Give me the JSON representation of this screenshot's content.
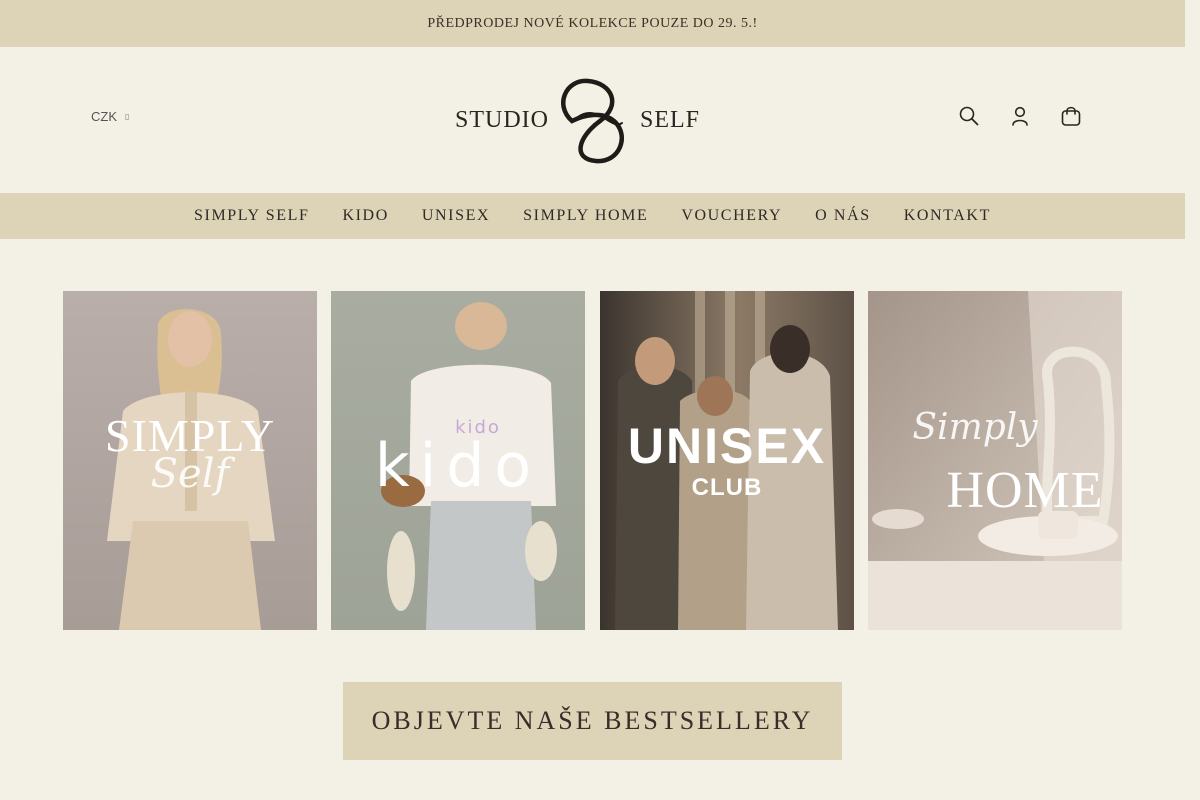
{
  "announcement": "PŘEDPRODEJ NOVÉ KOLEKCE POUZE DO 29. 5.!",
  "header": {
    "currency": "CZK",
    "logo_left": "STUDIO",
    "logo_right": "SELF"
  },
  "icons": [
    "search-icon",
    "account-icon",
    "cart-icon"
  ],
  "nav": {
    "items": [
      "SIMPLY SELF",
      "KIDO",
      "UNISEX",
      "SIMPLY HOME",
      "VOUCHERY",
      "O NÁS",
      "KONTAKT"
    ]
  },
  "tiles": [
    {
      "title": "SIMPLY",
      "script": "Self"
    },
    {
      "title": "kido",
      "script": "kido"
    },
    {
      "title": "UNISEX",
      "script": "CLUB"
    },
    {
      "title": "HOME",
      "script": "Simply"
    }
  ],
  "cta": "OBJEVTE NAŠE BESTSELLERY",
  "colors": {
    "background": "#f3f0e5",
    "band": "#ddd3b6",
    "text": "#2f2a25"
  }
}
